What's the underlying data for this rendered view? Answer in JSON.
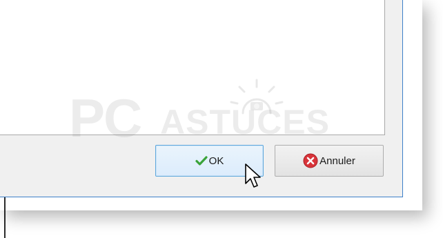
{
  "dialog": {
    "buttons": {
      "ok_label": "OK",
      "cancel_label": "Annuler"
    }
  },
  "watermark": {
    "part1": "PC",
    "part2": "ASTUCES"
  },
  "icons": {
    "ok": "check-icon",
    "cancel": "cancel-circle-icon",
    "cursor": "mouse-pointer-icon",
    "watermark_sun": "sun-camera-icon"
  },
  "colors": {
    "dialog_border": "#3c7fc9",
    "ok_border": "#5ea7dc",
    "check_green": "#3aa33a",
    "cancel_red": "#d8343a"
  }
}
